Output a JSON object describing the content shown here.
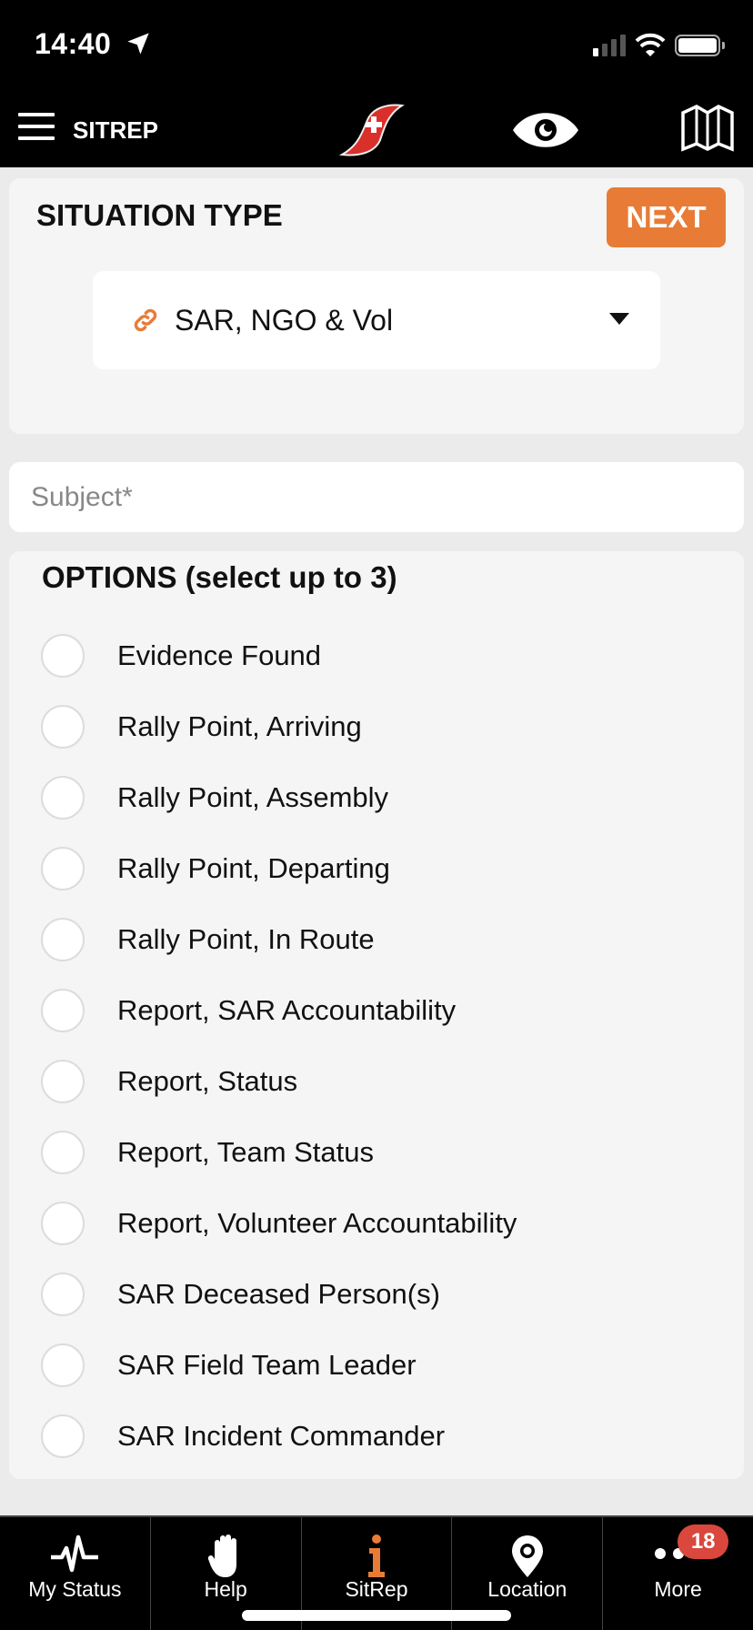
{
  "status_bar": {
    "time": "14:40"
  },
  "app_bar": {
    "title": "SITREP"
  },
  "situation": {
    "title": "SITUATION TYPE",
    "next_label": "NEXT",
    "selected_type": "SAR, NGO & Vol"
  },
  "subject": {
    "placeholder": "Subject*",
    "value": ""
  },
  "options": {
    "title": "OPTIONS (select up to 3)",
    "items": [
      {
        "label": "Evidence Found",
        "selected": false
      },
      {
        "label": "Rally Point, Arriving",
        "selected": false
      },
      {
        "label": "Rally Point, Assembly",
        "selected": false
      },
      {
        "label": "Rally Point, Departing",
        "selected": false
      },
      {
        "label": "Rally Point, In Route",
        "selected": false
      },
      {
        "label": "Report, SAR Accountability",
        "selected": false
      },
      {
        "label": "Report, Status",
        "selected": false
      },
      {
        "label": "Report, Team Status",
        "selected": false
      },
      {
        "label": "Report, Volunteer Accountability",
        "selected": false
      },
      {
        "label": "SAR Deceased Person(s)",
        "selected": false
      },
      {
        "label": "SAR Field Team Leader",
        "selected": false
      },
      {
        "label": "SAR Incident Commander",
        "selected": false
      }
    ]
  },
  "tabs": [
    {
      "label": "My Status",
      "icon": "pulse-icon"
    },
    {
      "label": "Help",
      "icon": "hand-icon"
    },
    {
      "label": "SitRep",
      "icon": "info-icon",
      "active": true
    },
    {
      "label": "Location",
      "icon": "location-pin-icon"
    },
    {
      "label": "More",
      "icon": "more-icon",
      "badge": "18"
    }
  ],
  "colors": {
    "accent": "#e87c37",
    "badge": "#d9473d",
    "logo_red": "#d9302c"
  }
}
